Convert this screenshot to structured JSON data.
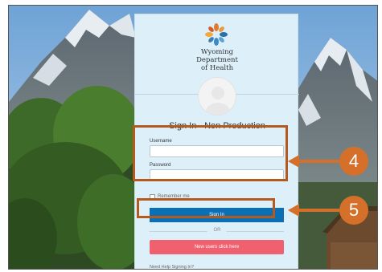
{
  "org": {
    "line1": "Wyoming",
    "line2": "Department",
    "line3": "of Health"
  },
  "signin": {
    "title": "Sign In - Non Production",
    "username_label": "Username",
    "username_value": "",
    "password_label": "Password",
    "password_value": "",
    "remember_label": "Remember me",
    "signin_button": "Sign In",
    "or_text": "OR",
    "new_user_button": "New users click here",
    "help_link": "Need Help Signing In?"
  },
  "callouts": [
    {
      "number": "4"
    },
    {
      "number": "5"
    }
  ],
  "colors": {
    "card_bg": "#ddf0fa",
    "signin_button": "#0b6fb5",
    "new_user_button": "#f0616f",
    "callout_border": "#b35a1f",
    "callout_badge": "#d5702b"
  },
  "icons": {
    "logo": "wdh-logo-icon",
    "avatar": "user-avatar-icon",
    "arrow": "arrow-left-icon"
  }
}
